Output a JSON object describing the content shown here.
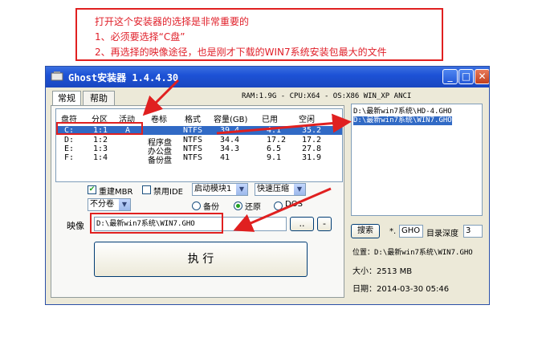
{
  "annotation": {
    "line1": "打开这个安装器的选择是非常重要的",
    "line2": "1、必须要选择“C盘”",
    "line3": "2、再选择的映像途径，也是刚才下载的WIN7系统安装包最大的文件"
  },
  "window": {
    "title": "Ghost安装器 1.4.4.30",
    "minimize": "_",
    "maximize": "□",
    "close": "✕"
  },
  "tabs": [
    "常规",
    "帮助"
  ],
  "sysinfo": "RAM:1.9G - CPU:X64 - OS:X86 WIN_XP ANCI",
  "table": {
    "headers": [
      "盘符",
      "分区",
      "活动",
      "卷标",
      "格式",
      "容量(GB)",
      "已用",
      "空闲"
    ],
    "rows": [
      {
        "drive": "C:",
        "part": "1:1",
        "active": "A",
        "label": "",
        "fs": "NTFS",
        "size": "39.4",
        "used": "4.1",
        "free": "35.2"
      },
      {
        "drive": "D:",
        "part": "1:2",
        "active": "",
        "label": "程序盘",
        "fs": "NTFS",
        "size": "34.4",
        "used": "17.2",
        "free": "17.2"
      },
      {
        "drive": "E:",
        "part": "1:3",
        "active": "",
        "label": "办公盘",
        "fs": "NTFS",
        "size": "34.3",
        "used": "6.5",
        "free": "27.8"
      },
      {
        "drive": "F:",
        "part": "1:4",
        "active": "",
        "label": "备份盘",
        "fs": "NTFS",
        "size": "41",
        "used": "9.1",
        "free": "31.9"
      }
    ]
  },
  "options": {
    "rebuild_mbr": "重建MBR",
    "disable_ide": "禁用IDE",
    "boot_mode": "启动模块1",
    "compress": "快速压缩",
    "volume": "不分卷",
    "backup": "备份",
    "restore": "还原",
    "dos": "DOS"
  },
  "image": {
    "label": "映像",
    "path": "D:\\最新win7系统\\WIN7.GHO",
    "browse": "..",
    "minus": "-"
  },
  "execute": "执      行",
  "files": [
    "D:\\最新win7系统\\HD-4.GHO",
    "D:\\最新win7系统\\WIN7.GHO"
  ],
  "search": {
    "button": "搜索",
    "star": "*.",
    "ext": "GHO",
    "depth_label": "目录深度",
    "depth": "3"
  },
  "details": {
    "location": "位置：D:\\最新win7系统\\WIN7.GHO",
    "size": "大小：2513 MB",
    "date": "日期：2014-03-30   05:46"
  }
}
